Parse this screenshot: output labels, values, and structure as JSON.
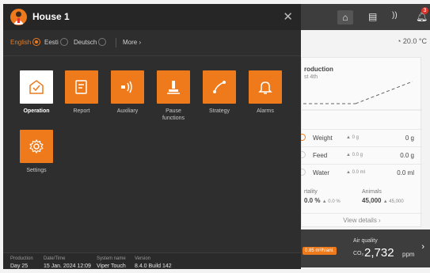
{
  "background": {
    "temperature": "20.0 °C",
    "production": {
      "title": "roduction",
      "subtitle": "st 4th",
      "axis_ticks": [
        "",
        "",
        "",
        ""
      ]
    },
    "rows": [
      {
        "label": "Weight",
        "change": "▲ 0 g",
        "value": "0 g"
      },
      {
        "label": "Feed",
        "change": "▲ 0.0 g",
        "value": "0.0 g"
      },
      {
        "label": "Water",
        "change": "▲ 0.0 ml",
        "value": "0.0 ml"
      }
    ],
    "mortality": {
      "label": "rtality",
      "value": "0.0 %",
      "change": "▲ 0.0 %"
    },
    "animals": {
      "label": "Animals",
      "value": "45,000",
      "change": "▲ 45,000"
    },
    "view_details": "View details",
    "air_speed": "0.85 m³/h/anl.",
    "air_quality": {
      "label": "Air quality",
      "gas": "CO₂",
      "value": "2,732",
      "unit": "ppm"
    },
    "notification_count": "3"
  },
  "modal": {
    "title": "House 1",
    "languages": [
      {
        "label": "English",
        "selected": true
      },
      {
        "label": "Eesti",
        "selected": false
      },
      {
        "label": "Deutsch",
        "selected": false
      }
    ],
    "more_label": "More",
    "tiles": [
      {
        "id": "operation",
        "label": "Operation",
        "icon": "checkmark-house-icon",
        "active": true
      },
      {
        "id": "report",
        "label": "Report",
        "icon": "report-icon",
        "active": false
      },
      {
        "id": "auxiliary",
        "label": "Auxiliary",
        "icon": "auxiliary-icon",
        "active": false
      },
      {
        "id": "pause",
        "label": "Pause\nfunctions",
        "icon": "pause-icon",
        "active": false
      },
      {
        "id": "strategy",
        "label": "Strategy",
        "icon": "strategy-icon",
        "active": false
      },
      {
        "id": "alarms",
        "label": "Alarms",
        "icon": "bell-icon",
        "active": false
      },
      {
        "id": "settings",
        "label": "Settings",
        "icon": "gear-icon",
        "active": false
      }
    ],
    "footer": {
      "production": {
        "label": "Production",
        "value": "Day 25"
      },
      "datetime": {
        "label": "Date/Time",
        "value": "15 Jan. 2024 12:09"
      },
      "system": {
        "label": "System name",
        "value": "Viper Touch"
      },
      "version": {
        "label": "Version",
        "value": "8.4.0 Build 142"
      }
    }
  },
  "colors": {
    "accent": "#ee7a1c",
    "modal_bg": "#2e2e2e",
    "header_bg": "#262626"
  }
}
